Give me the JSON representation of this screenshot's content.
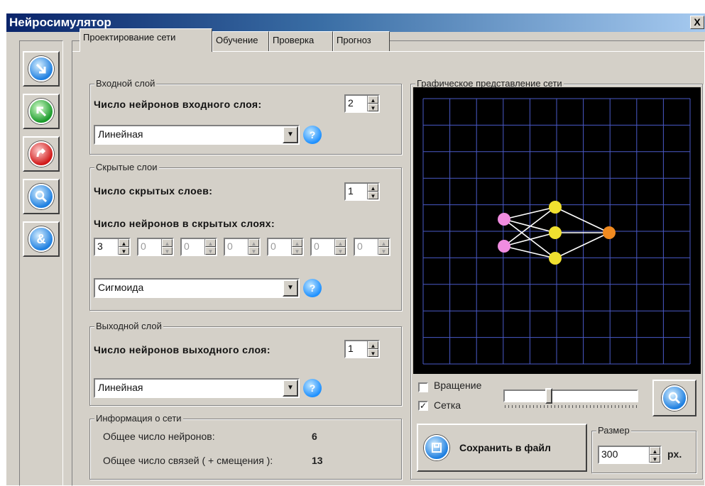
{
  "window": {
    "title": "Нейросимулятор",
    "close_label": "X"
  },
  "toolbar": {
    "icons": [
      "arrow-down-right-icon",
      "arrow-up-left-icon",
      "undo-icon",
      "search-icon",
      "ampersand-icon"
    ]
  },
  "tabs": [
    {
      "label": "Проектирование сети",
      "active": true
    },
    {
      "label": "Обучение",
      "active": false
    },
    {
      "label": "Проверка",
      "active": false
    },
    {
      "label": "Прогноз",
      "active": false
    }
  ],
  "input_layer": {
    "group_label": "Входной слой",
    "neurons_label": "Число нейронов входного слоя:",
    "neurons_value": "2",
    "activation": "Линейная"
  },
  "hidden_layers": {
    "group_label": "Скрытые слои",
    "layers_label": "Число скрытых слоев:",
    "layers_value": "1",
    "neurons_label": "Число нейронов в скрытых слоях:",
    "neurons": [
      "3",
      "0",
      "0",
      "0",
      "0",
      "0",
      "0"
    ],
    "activation": "Сигмоида"
  },
  "output_layer": {
    "group_label": "Выходной слой",
    "neurons_label": "Число нейронов выходного слоя:",
    "neurons_value": "1",
    "activation": "Линейная"
  },
  "info": {
    "group_label": "Информация о сети",
    "total_neurons_label": "Общее число нейронов:",
    "total_neurons": "6",
    "total_links_label": "Общее число связей ( + смещения ):",
    "total_links": "13"
  },
  "graph": {
    "group_label": "Графическое представление сети",
    "colors": {
      "background": "#000000",
      "grid": "#4a5ac8",
      "input": "#f08ce0",
      "hidden": "#f0e030",
      "output": "#f08a20",
      "edge": "#ffffff"
    },
    "layers": [
      2,
      3,
      1
    ]
  },
  "controls": {
    "rotation_label": "Вращение",
    "rotation_checked": false,
    "grid_label": "Сетка",
    "grid_checked": true,
    "slider_level": 0.33,
    "save_label": "Сохранить в файл",
    "size_group_label": "Размер",
    "size_value": "300",
    "size_unit": "px."
  }
}
